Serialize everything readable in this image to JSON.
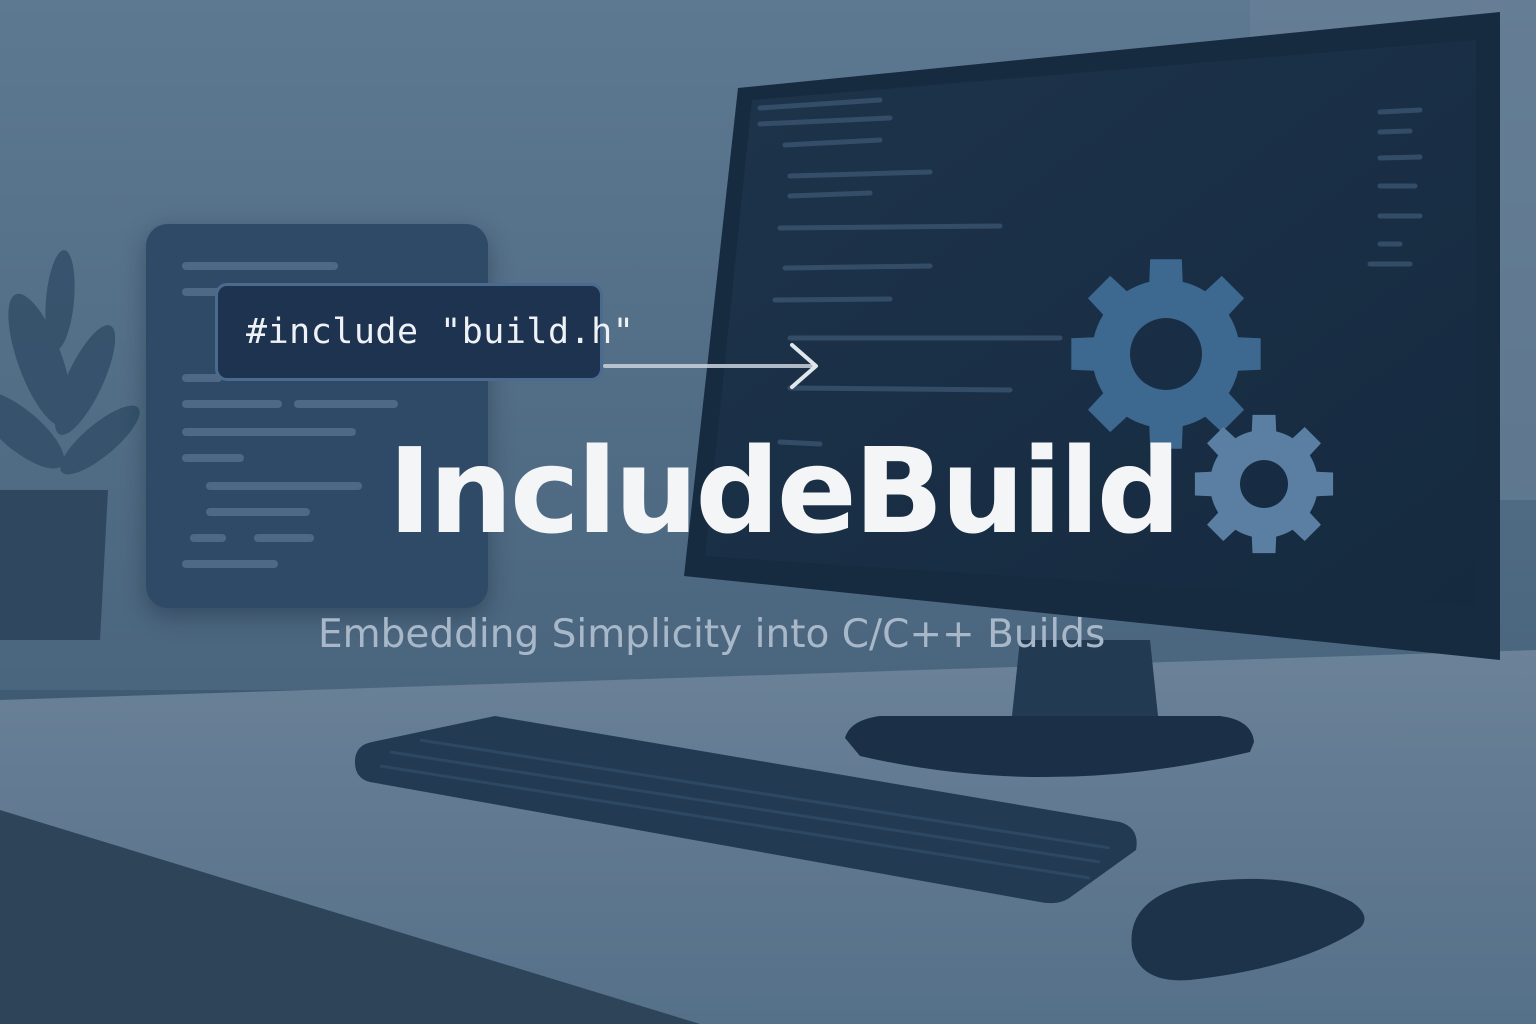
{
  "banner": {
    "code_snippet": "#include \"build.h\"",
    "title": "IncludeBuild",
    "subtitle": "Embedding Simplicity into C/C++ Builds"
  },
  "icons": {
    "large_gear": "gear-icon",
    "small_gear": "gear-icon",
    "arrow": "arrow-right-icon"
  },
  "colors": {
    "background_tint": "#3f5a73",
    "card": "#2f4a66",
    "chip": "#1d3350",
    "gear_large": "#3d6890",
    "gear_small": "#5a7fa3",
    "title": "#f3f5f7",
    "subtitle": "#a8b8c8"
  }
}
